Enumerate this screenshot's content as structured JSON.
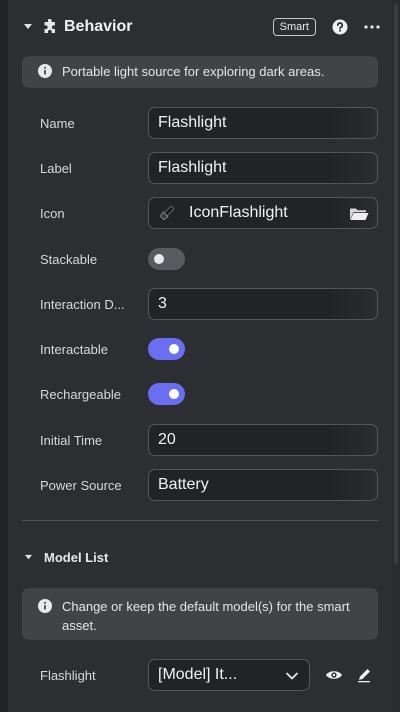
{
  "header": {
    "title": "Behavior",
    "badge": "Smart"
  },
  "info_banner": {
    "text": "Portable light source for exploring dark areas."
  },
  "properties": {
    "name": {
      "label": "Name",
      "value": "Flashlight"
    },
    "label": {
      "label": "Label",
      "value": "Flashlight"
    },
    "icon": {
      "label": "Icon",
      "value": "IconFlashlight"
    },
    "stackable": {
      "label": "Stackable",
      "checked": false
    },
    "interaction_distance": {
      "label": "Interaction D...",
      "value": "3"
    },
    "interactable": {
      "label": "Interactable",
      "checked": true
    },
    "rechargeable": {
      "label": "Rechargeable",
      "checked": true
    },
    "initial_time": {
      "label": "Initial Time",
      "value": "20"
    },
    "power_source": {
      "label": "Power Source",
      "value": "Battery"
    }
  },
  "model_list": {
    "title": "Model List",
    "info_text": "Change or keep the default model(s) for the smart asset.",
    "item": {
      "label": "Flashlight",
      "selected": "[Model] It..."
    }
  },
  "colors": {
    "accent": "#6a6ff2",
    "panel": "#2d2e32",
    "field": "#222326"
  }
}
